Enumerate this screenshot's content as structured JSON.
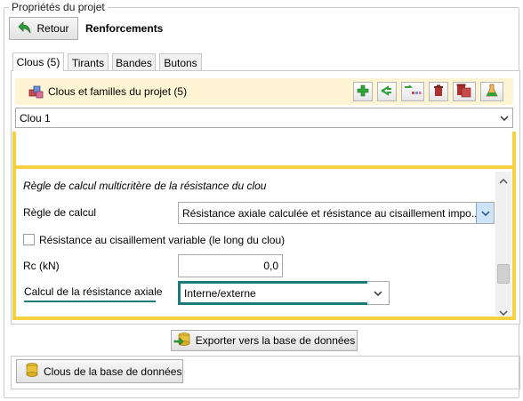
{
  "group": {
    "title": "Propriétés du projet"
  },
  "header": {
    "back_label": "Retour",
    "section_title": "Renforcements"
  },
  "tabs": [
    {
      "label": "Clous (5)",
      "active": true
    },
    {
      "label": "Tirants"
    },
    {
      "label": "Bandes"
    },
    {
      "label": "Butons"
    }
  ],
  "list": {
    "title": "Clous et familles du projet (5)",
    "toolbar_icons": [
      "add-icon",
      "branch-icon",
      "import-icon",
      "delete-icon",
      "delete-family-icon",
      "test-icon"
    ],
    "selected": "Clou 1"
  },
  "rules": {
    "title": "Règle de calcul multicritère de la résistance du clou",
    "calc_rule_label": "Règle de calcul",
    "calc_rule_value": "Résistance axiale calculée et résistance au cisaillement impo...",
    "variable_shear_label": "Résistance au cisaillement variable (le long du clou)",
    "variable_shear_checked": false,
    "rc_label": "Rc (kN)",
    "rc_value": "0,0",
    "axial_label": "Calcul de la résistance axiale",
    "axial_value": "Interne/externe"
  },
  "footer": {
    "export_label": "Exporter vers la base de données",
    "db_label": "Clous de la base de données"
  },
  "colors": {
    "highlight_yellow": "#f5d142",
    "list_header_bg": "#fff5d4",
    "teal_accent": "#1a7a77",
    "combo_arrow_blue": "#cde3f7"
  }
}
